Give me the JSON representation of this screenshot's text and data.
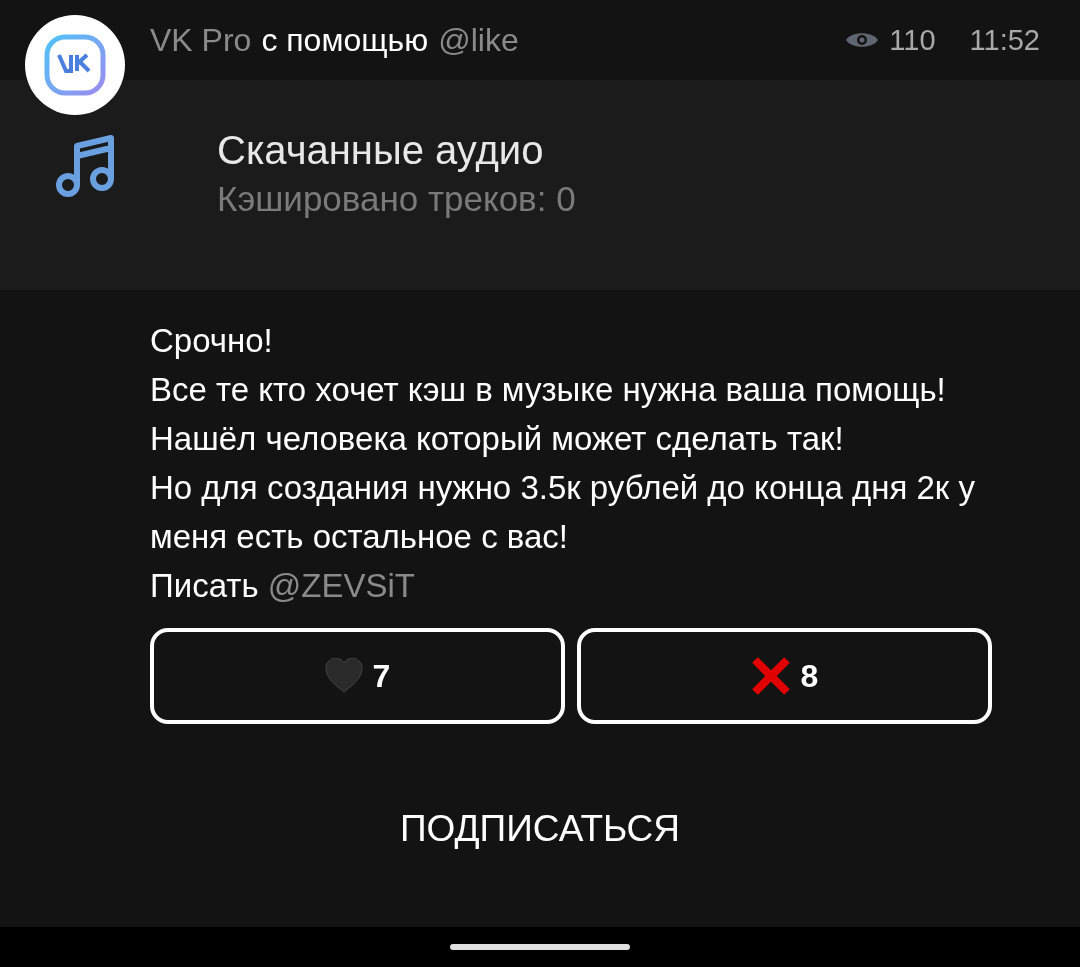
{
  "header": {
    "channel": "VK Pro",
    "via": "с помощью",
    "bot": "@like",
    "views": "110",
    "time": "11:52"
  },
  "audio_card": {
    "title": "Скачанные аудио",
    "subtitle": "Кэшировано треков: 0"
  },
  "message": {
    "lines": [
      "Срочно!",
      "Все те кто хочет кэш в музыке нужна ваша помощь!",
      "Нашёл человека который может сделать так!",
      "Но для создания нужно 3.5к рублей до конца дня 2к у меня есть остальное с вас!"
    ],
    "prefix": "Писать",
    "mention": "@ZEVSiT"
  },
  "buttons": [
    {
      "kind": "heart",
      "count": "7"
    },
    {
      "kind": "cross",
      "count": "8"
    }
  ],
  "subscribe": "ПОДПИСАТЬСЯ"
}
